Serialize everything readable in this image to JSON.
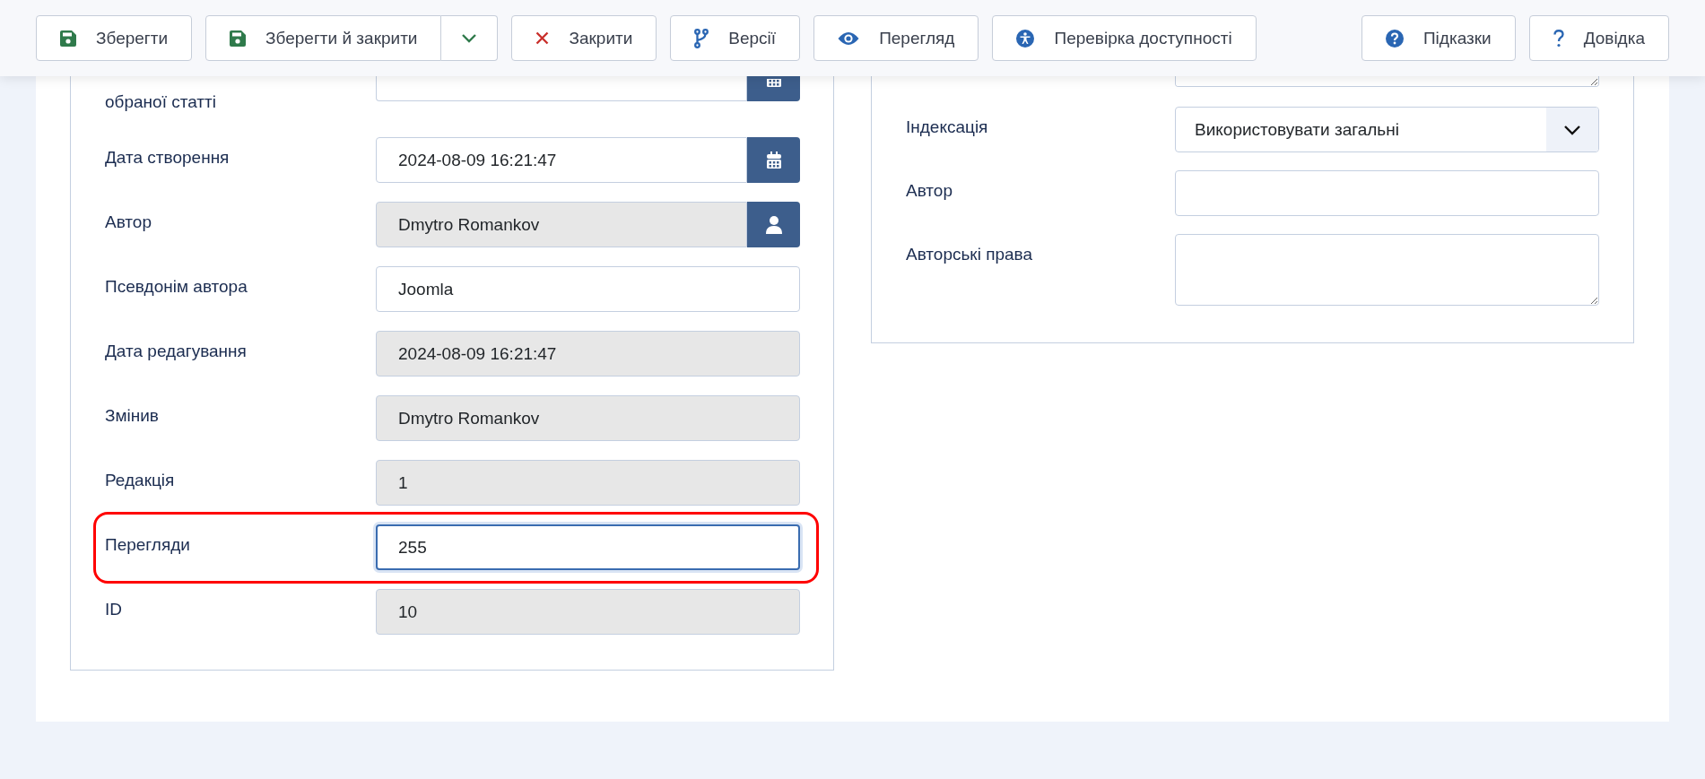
{
  "toolbar": {
    "buttons": [
      {
        "label": "Зберегти",
        "kind": "save",
        "dropdown": false
      },
      {
        "label": "Зберегти й закрити",
        "kind": "save",
        "dropdown": true
      },
      {
        "label": "Закрити",
        "kind": "close",
        "dropdown": false
      },
      {
        "label": "Версії",
        "kind": "versions",
        "dropdown": false
      },
      {
        "label": "Перегляд",
        "kind": "preview",
        "dropdown": false
      },
      {
        "label": "Перевірка доступності",
        "kind": "accessibility",
        "dropdown": false
      }
    ],
    "help_buttons": [
      {
        "label": "Підказки",
        "kind": "tips"
      },
      {
        "label": "Довідка",
        "kind": "help"
      }
    ]
  },
  "left_fields": [
    {
      "label": "обраної статті",
      "kind": "calendar",
      "readonly": false,
      "highlighted": false,
      "focused": false
    },
    {
      "label": "Дата створення",
      "kind": "calendar",
      "value": "2024-08-09 16:21:47",
      "readonly": false,
      "highlighted": false,
      "focused": false
    },
    {
      "label": "Автор",
      "kind": "user",
      "value": "Dmytro Romankov",
      "readonly": true,
      "highlighted": false,
      "focused": false
    },
    {
      "label": "Псевдонім автора",
      "kind": "text",
      "value": "Joomla",
      "readonly": false,
      "highlighted": false,
      "focused": false
    },
    {
      "label": "Дата редагування",
      "kind": "text",
      "value": "2024-08-09 16:21:47",
      "readonly": true,
      "highlighted": false,
      "focused": false
    },
    {
      "label": "Змінив",
      "kind": "text",
      "value": "Dmytro Romankov",
      "readonly": true,
      "highlighted": false,
      "focused": false
    },
    {
      "label": "Редакція",
      "kind": "text",
      "value": "1",
      "readonly": true,
      "highlighted": false,
      "focused": false
    },
    {
      "label": "Перегляди",
      "kind": "text",
      "value": "255",
      "readonly": false,
      "highlighted": true,
      "focused": true
    },
    {
      "label": "ID",
      "kind": "text",
      "value": "10",
      "readonly": true,
      "highlighted": false,
      "focused": false
    }
  ],
  "right_fields": [
    {
      "kind": "textarea"
    },
    {
      "label": "Індексація",
      "kind": "select",
      "value": "Використовувати загальні"
    },
    {
      "label": "Автор",
      "kind": "text"
    },
    {
      "label": "Авторські права",
      "kind": "textarea"
    }
  ]
}
